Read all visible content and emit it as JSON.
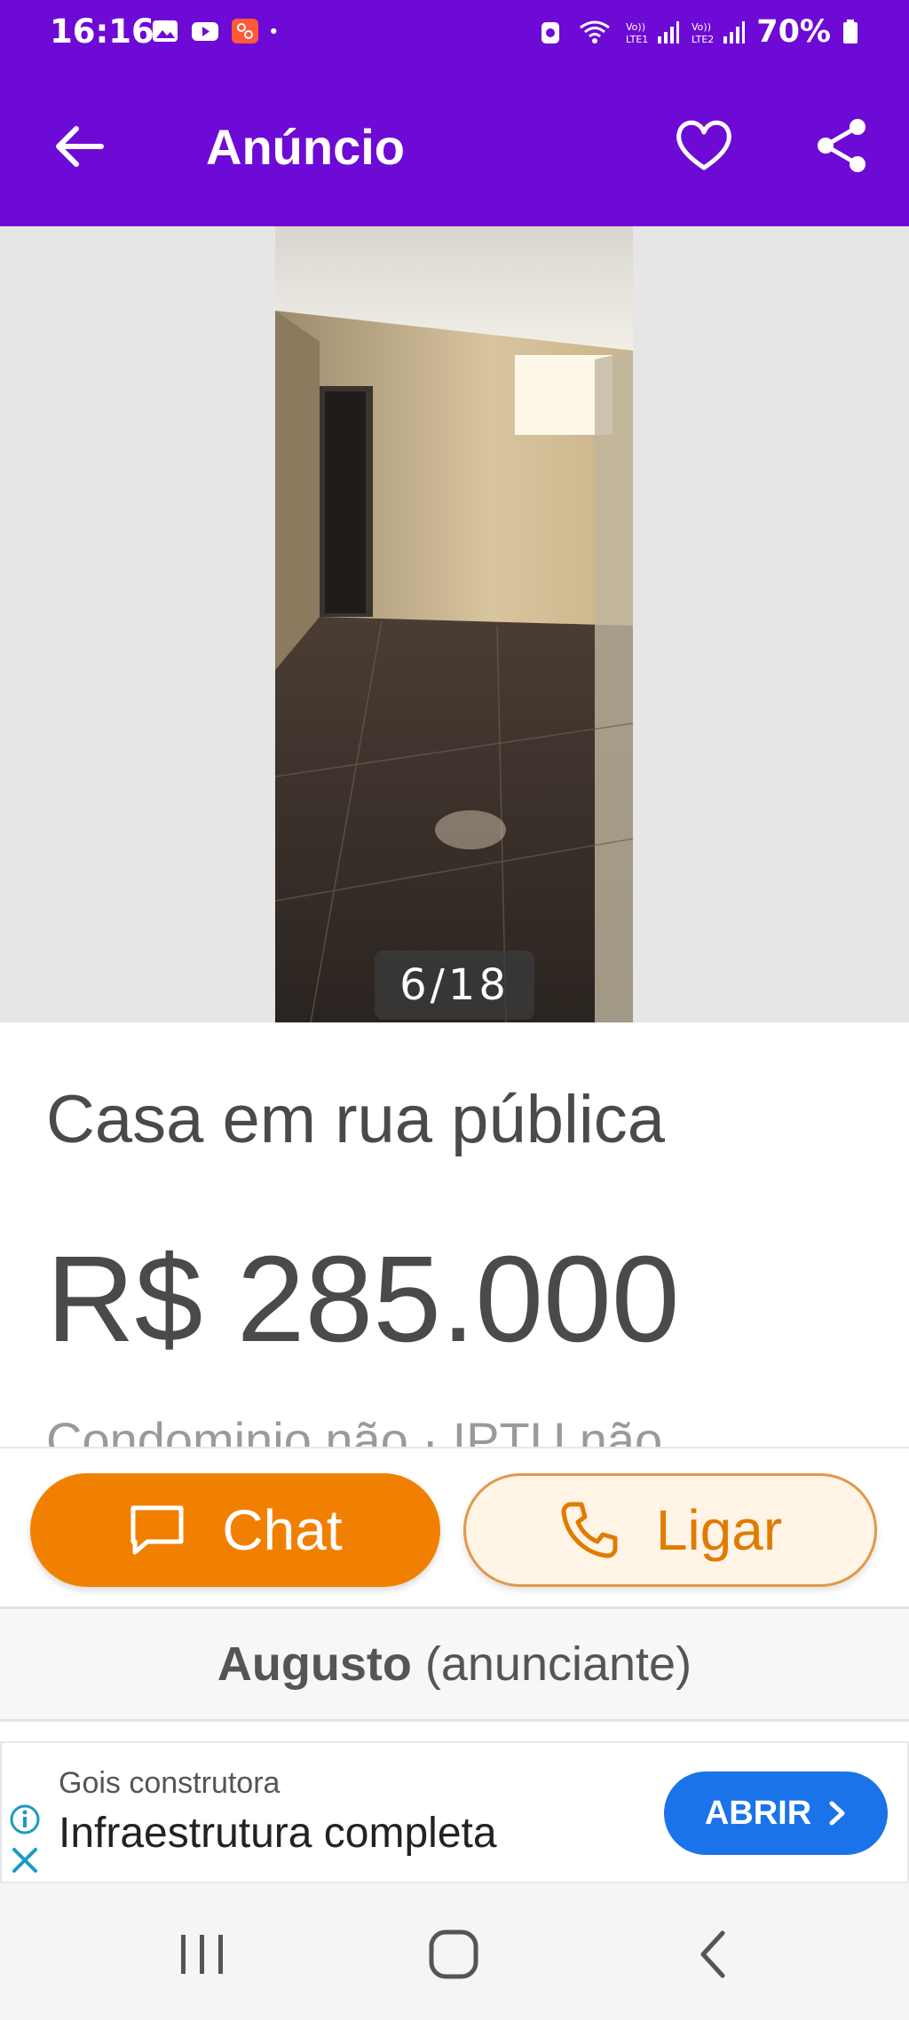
{
  "status_bar": {
    "time": "16:16",
    "battery": "70%"
  },
  "header": {
    "title": "Anúncio"
  },
  "gallery": {
    "counter": "6/18"
  },
  "listing": {
    "title": "Casa em rua pública",
    "price": "R$ 285.000",
    "fees": "Condominio não · IPTU não"
  },
  "actions": {
    "chat_label": "Chat",
    "call_label": "Ligar"
  },
  "seller": {
    "name": "Augusto",
    "role": "(anunciante)"
  },
  "ad": {
    "advertiser": "Gois construtora",
    "headline": "Infraestrutura completa",
    "cta": "ABRIR"
  },
  "colors": {
    "brand_purple": "#6e0ad6",
    "chat_orange": "#f28000",
    "call_bg": "#fff4e5",
    "ad_blue": "#1a73e8"
  }
}
